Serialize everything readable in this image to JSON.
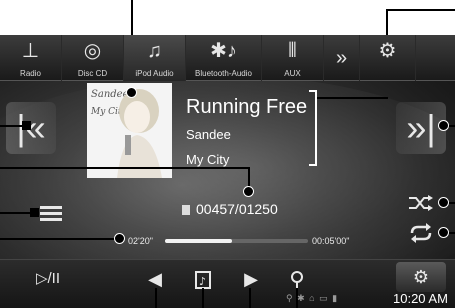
{
  "sources": [
    {
      "label": "Radio",
      "icon": "radio-antenna-icon"
    },
    {
      "label": "Disc CD",
      "icon": "disc-icon"
    },
    {
      "label": "iPod Audio",
      "icon": "music-note-icon"
    },
    {
      "label": "Bluetooth-Audio",
      "icon": "bluetooth-audio-icon"
    },
    {
      "label": "AUX",
      "icon": "aux-input-icon"
    },
    {
      "label": "»",
      "icon": "more-sources-icon"
    },
    {
      "label": "",
      "icon": "setup-icon"
    }
  ],
  "album_art": {
    "line1": "Sandee",
    "line2": "My City"
  },
  "track": {
    "title": "Running Free",
    "artist": "Sandee",
    "album": "My City",
    "number": "00457/01250",
    "elapsed": "02'20\"",
    "total": "00:05'00\"",
    "progress_fraction": 0.47
  },
  "buttons": {
    "prev_track": "|«",
    "next_track": "»|",
    "play_pause": "▷/II",
    "list": "list-icon",
    "shuffle": "shuffle-icon",
    "repeat": "repeat-icon",
    "rewind": "◀",
    "album_view": "album-icon",
    "forward": "▶",
    "search": "search-icon"
  },
  "status_icons": "⚲ ✱ ⌂ ▭ ▮",
  "clock": "10:20 AM"
}
